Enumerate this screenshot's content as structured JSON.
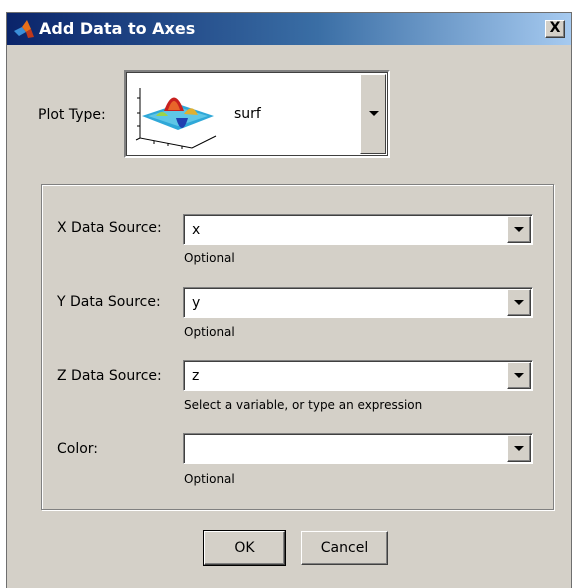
{
  "window": {
    "title": "Add Data to Axes",
    "close_glyph": "X"
  },
  "plot_type": {
    "label": "Plot Type:",
    "value": "surf",
    "thumbnail_icon": "surf-plot-thumbnail-icon"
  },
  "fields": [
    {
      "label": "X Data Source:",
      "value": "x",
      "hint": "Optional"
    },
    {
      "label": "Y Data Source:",
      "value": "y",
      "hint": "Optional"
    },
    {
      "label": "Z Data Source:",
      "value": "z",
      "hint": "Select a variable, or type an expression"
    },
    {
      "label": "Color:",
      "value": "",
      "hint": "Optional"
    }
  ],
  "buttons": {
    "ok": "OK",
    "cancel": "Cancel"
  },
  "colors": {
    "dialog_bg": "#d4d0c8",
    "title_gradient_start": "#0a246a",
    "title_gradient_end": "#a6caf0"
  }
}
